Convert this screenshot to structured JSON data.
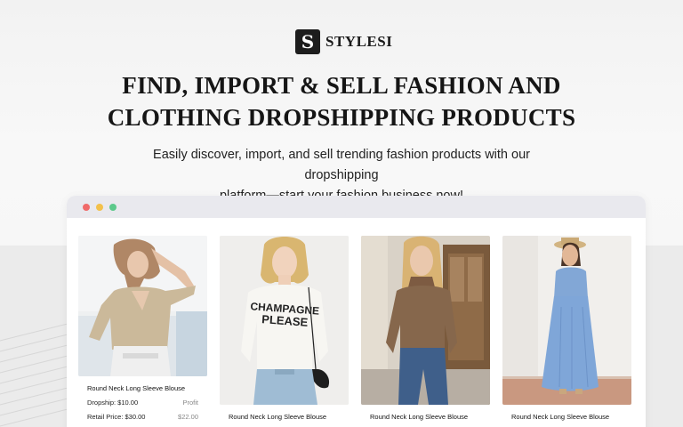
{
  "brand": {
    "logo_letter": "S",
    "name": "STYLESI"
  },
  "hero": {
    "headline_line1": "FIND, IMPORT & SELL FASHION AND",
    "headline_line2": "CLOTHING DROPSHIPPING PRODUCTS",
    "subtitle_line1": "Easily discover, import, and sell trending fashion products with our dropshipping",
    "subtitle_line2": "platform—start your fashion business now!"
  },
  "products": [
    {
      "title": "Round Neck Long Sleeve Blouse",
      "dropship_label": "Dropship: $10.00",
      "profit_label": "Profit",
      "retail_label": "Retail Price: $30.00",
      "profit_value": "$22.00"
    },
    {
      "title": "Round Neck Long Sleeve Blouse",
      "shirt_text_1": "CHAMPAGNE",
      "shirt_text_2": "PLEASE"
    },
    {
      "title": "Round Neck Long Sleeve Blouse"
    },
    {
      "title": "Round Neck Long Sleeve Blouse"
    }
  ],
  "colors": {
    "dot_red": "#f06a6a",
    "dot_yellow": "#f3c14b",
    "dot_green": "#5cc98b",
    "logo_bg": "#1d1d1d"
  }
}
